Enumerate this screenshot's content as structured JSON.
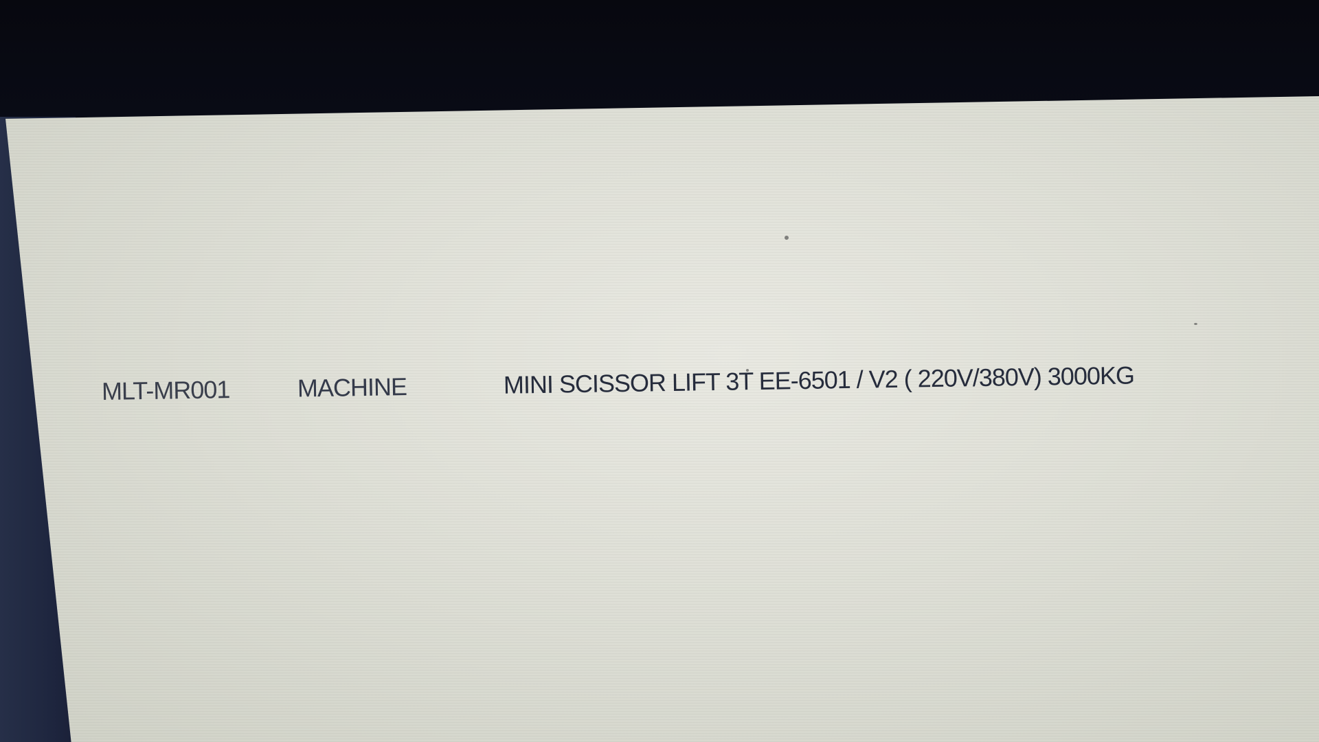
{
  "window": {
    "background_color": "#dcddd4"
  },
  "record": {
    "item_code": "MLT-MR001",
    "category": "MACHINE",
    "description": "MINI SCISSOR LIFT 3T EE-6501 / V2 ( 220V/380V) 3000KG"
  }
}
